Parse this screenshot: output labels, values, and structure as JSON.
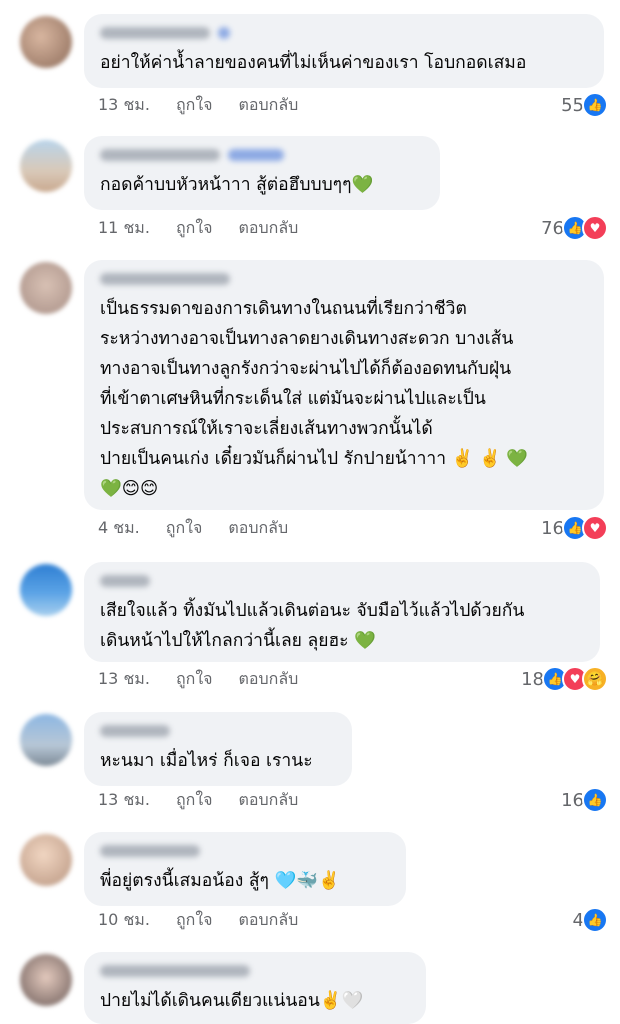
{
  "comments": [
    {
      "text": "อย่าให้ค่าน้ำลายของคนที่ไม่เห็นค่าของเรา โอบกอดเสมอ",
      "time": "13 ชม.",
      "like": "ถูกใจ",
      "reply": "ตอบกลับ",
      "count": "55",
      "reactions": [
        "like"
      ]
    },
    {
      "text": "กอดค้าบบหัวหน้าาา สู้ต่อฮึบบบๆๆ💚",
      "time": "11 ชม.",
      "like": "ถูกใจ",
      "reply": "ตอบกลับ",
      "count": "76",
      "reactions": [
        "like",
        "love"
      ]
    },
    {
      "text": "เป็นธรรมดาของการเดินทางในถนนที่เรียกว่าชีวิต\nระหว่างทางอาจเป็นทางลาดยางเดินทางสะดวก บางเส้น\nทางอาจเป็นทางลูกรังกว่าจะผ่านไปได้ก็ต้องอดทนกับฝุ่น\nที่เข้าตาเศษหินที่กระเด็นใส่ แต่มันจะผ่านไปและเป็น\nประสบการณ์ให้เราจะเลี่ยงเส้นทางพวกนั้นได้\nปายเป็นคนเก่ง เดี๋ยวมันก็ผ่านไป รักปายน้าาาา ✌️ ✌️ 💚\n💚😊😊",
      "time": "4 ชม.",
      "like": "ถูกใจ",
      "reply": "ตอบกลับ",
      "count": "16",
      "reactions": [
        "like",
        "love"
      ]
    },
    {
      "text": "เสียใจแล้ว ทิ้งมันไปแล้วเดินต่อนะ จับมือไว้แล้วไปด้วยกัน\nเดินหน้าไปให้ไกลกว่านี้เลย ลุยฮะ 💚",
      "time": "13 ชม.",
      "like": "ถูกใจ",
      "reply": "ตอบกลับ",
      "count": "18",
      "reactions": [
        "like",
        "love",
        "care"
      ]
    },
    {
      "text": "หะนมา เมื่อไหร่ ก็เจอ เรานะ",
      "time": "13 ชม.",
      "like": "ถูกใจ",
      "reply": "ตอบกลับ",
      "count": "16",
      "reactions": [
        "like"
      ]
    },
    {
      "text": "พี่อยู่ตรงนี้เสมอน้อง สู้ๆ 🩵🐳✌️",
      "time": "10 ชม.",
      "like": "ถูกใจ",
      "reply": "ตอบกลับ",
      "count": "4",
      "reactions": [
        "like"
      ]
    },
    {
      "text": "ปายไม่ได้เดินคนเดียวแน่นอน✌️🤍",
      "time": "",
      "like": "",
      "reply": "",
      "count": "",
      "reactions": []
    }
  ],
  "colors": {
    "bubble": "#f0f2f5",
    "meta": "#65676b",
    "like": "#1877f2",
    "love": "#f33e58",
    "care": "#f7b125"
  }
}
